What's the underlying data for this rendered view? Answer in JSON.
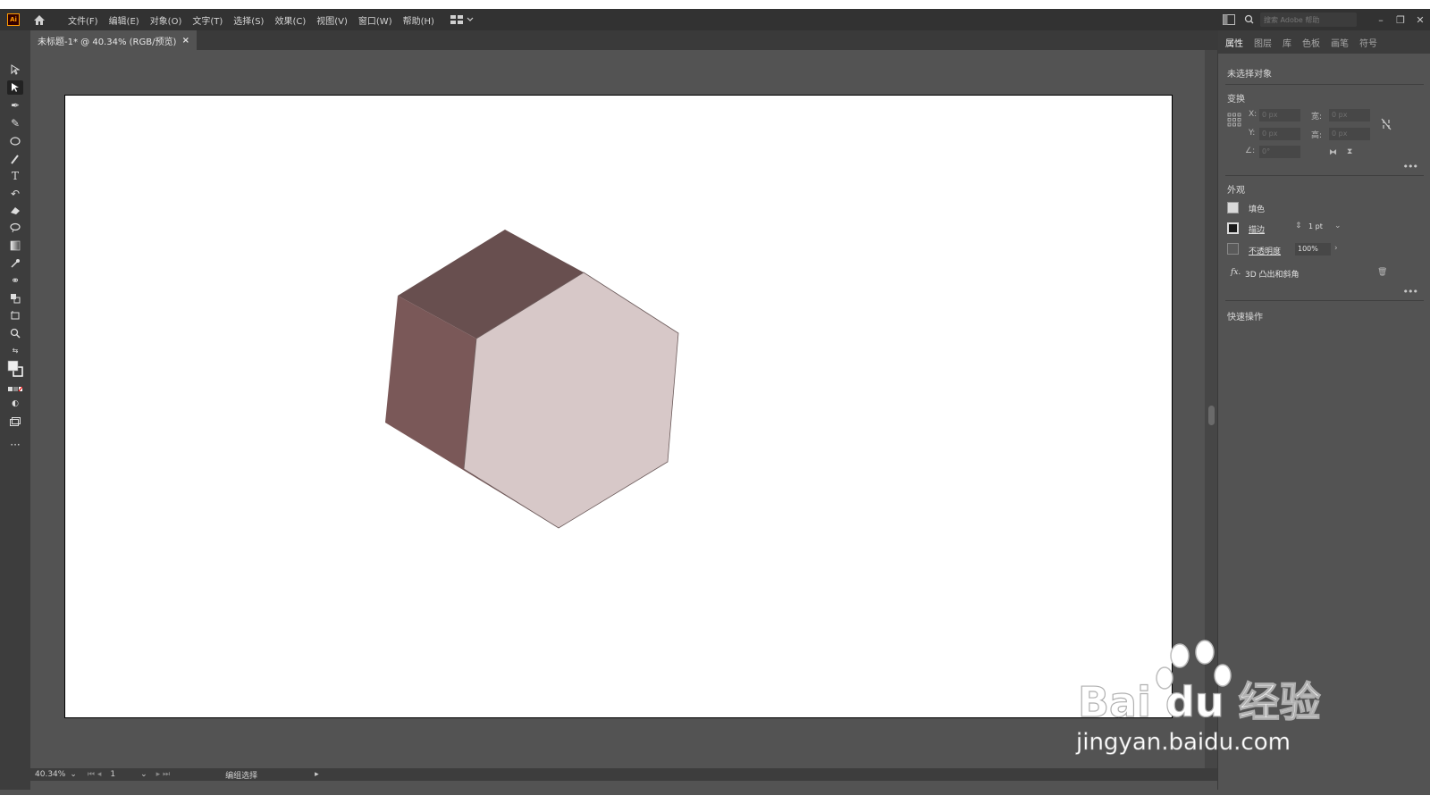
{
  "menubar": {
    "logo": "Ai",
    "items": [
      "文件(F)",
      "编辑(E)",
      "对象(O)",
      "文字(T)",
      "选择(S)",
      "效果(C)",
      "视图(V)",
      "窗口(W)",
      "帮助(H)"
    ],
    "search_placeholder": "搜索 Adobe 帮助"
  },
  "document": {
    "tab_title": "未标题-1* @ 40.34% (RGB/预览)",
    "close": "×"
  },
  "statusbar": {
    "zoom": "40.34%",
    "page": "1",
    "mode": "编组选择"
  },
  "panel": {
    "tabs": [
      "属性",
      "图层",
      "库",
      "色板",
      "画笔",
      "符号"
    ],
    "active_tab": "属性",
    "no_selection": "未选择对象",
    "transform": {
      "title": "变换",
      "x_label": "X:",
      "x_value": "0 px",
      "y_label": "Y:",
      "y_value": "0 px",
      "w_label": "宽:",
      "w_value": "0 px",
      "h_label": "高:",
      "h_value": "0 px",
      "angle_value": "0°"
    },
    "appearance": {
      "title": "外观",
      "fill_label": "填色",
      "stroke_label": "描边",
      "stroke_value": "1 pt",
      "opacity_label": "不透明度",
      "opacity_value": "100%",
      "effect_label": "3D 凸出和斜角"
    },
    "quick_actions": "快速操作"
  },
  "artwork": {
    "top_face_color": "#684f4f",
    "left_face_color": "#7a5858",
    "front_face_color": "#d7c8c8"
  },
  "watermark": {
    "brand": "Bai du 经验",
    "url": "jingyan.baidu.com"
  }
}
